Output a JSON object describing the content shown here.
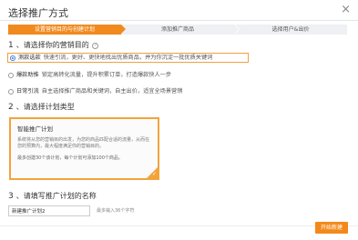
{
  "dialog": {
    "title": "选择推广方式",
    "close_glyph": "×"
  },
  "steps": [
    {
      "label": "设置营销目的与创建计划",
      "active": true
    },
    {
      "label": "添加推广商品",
      "active": false
    },
    {
      "label": "选择用户&出价",
      "active": false
    }
  ],
  "section1": {
    "number": "1",
    "heading": "、请选择你的营销目的",
    "help_glyph": "?",
    "options": [
      {
        "name": "测款选款",
        "desc": "快速引流，更好、更快地找出优质商品，并为你沉淀一批优质关键词",
        "selected": true
      },
      {
        "name": "爆款助推",
        "desc": "锁定高转化流量，提升积累订单，打造爆款快人一步",
        "selected": false
      },
      {
        "name": "日常引流",
        "desc": "自主选择推广商品和关键词，自主出价，适宜全场景营销",
        "selected": false
      }
    ]
  },
  "section2": {
    "number": "2",
    "heading": "、请选择计划类型",
    "card": {
      "title": "智能推广计划",
      "desc": "系统将从您的营销目的出发，为您的商品匹配合适的流量，从而在您的预算内，最大程度满足你的营销目的。",
      "limit": "最多创建30个该计划，每个计划可添加100个商品。",
      "check_glyph": "✓"
    }
  },
  "section3": {
    "number": "3",
    "heading": "、请填写推广计划的名称",
    "input_value": "新建推广计划2",
    "hint": "最多输入36个字符"
  },
  "footer": {
    "start_label": "开始新建"
  },
  "colors": {
    "accent": "#f08a1f",
    "selected_border": "#f0a040",
    "radio_on": "#3a7fd5"
  }
}
